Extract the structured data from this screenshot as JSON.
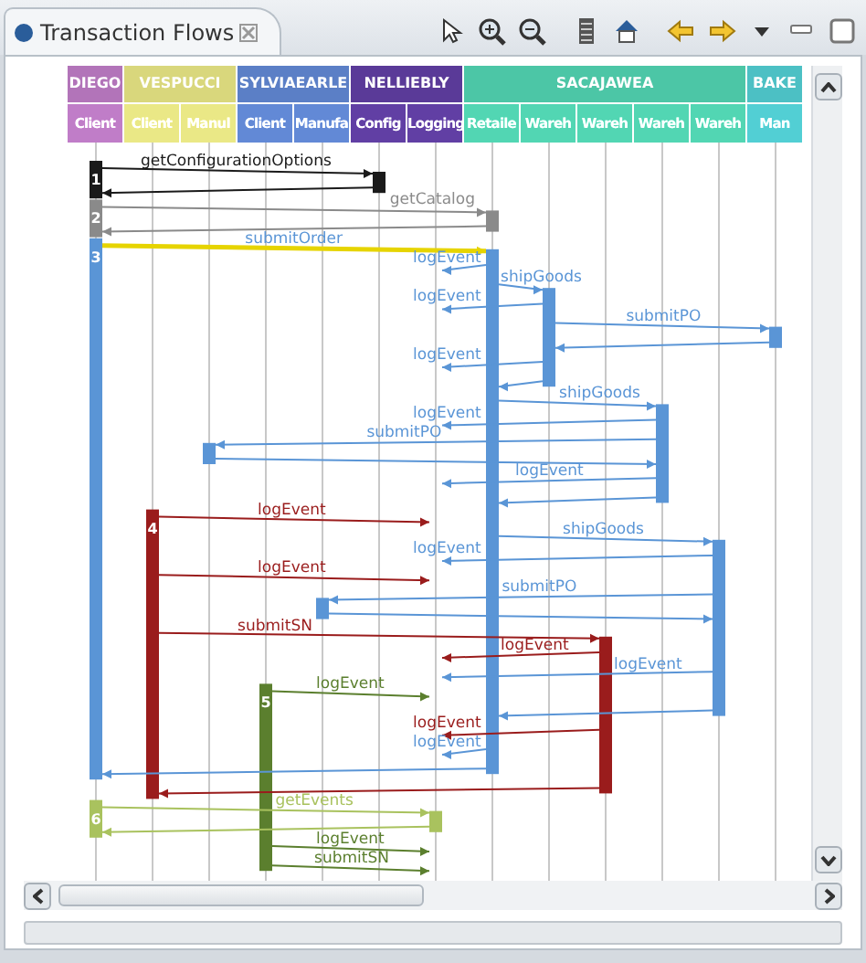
{
  "window": {
    "title": "Transaction Flows"
  },
  "participants": [
    {
      "name": "DIEGO",
      "color": "#b274b9",
      "roles": [
        "Client"
      ]
    },
    {
      "name": "VESPUCCI",
      "color": "#d9d77c",
      "roles": [
        "Client",
        "Manul"
      ]
    },
    {
      "name": "SYLVIAEARLE",
      "color": "#5b7fc6",
      "roles": [
        "Client",
        "Manufa"
      ]
    },
    {
      "name": "NELLIEBLY",
      "color": "#5a3a98",
      "roles": [
        "Config",
        "Logging"
      ]
    },
    {
      "name": "SACAJAWEA",
      "color": "#4cc6a6",
      "roles": [
        "Retaile",
        "Wareh",
        "Wareh",
        "Wareh",
        "Wareh"
      ]
    },
    {
      "name": "BAKE",
      "color": "#4cc0c4",
      "roles": [
        "Man"
      ]
    }
  ],
  "flows": [
    {
      "number": "1",
      "color": "#1a1a1a"
    },
    {
      "number": "2",
      "color": "#8a8a8a"
    },
    {
      "number": "3",
      "color": "#5a95d6"
    },
    {
      "number": "4",
      "color": "#9a1c1c"
    },
    {
      "number": "5",
      "color": "#5b7f2e"
    },
    {
      "number": "6",
      "color": "#a9c25e"
    }
  ],
  "messages": [
    {
      "kind": "call",
      "label": "getConfigurationOptions",
      "selected": false
    },
    {
      "kind": "return",
      "selected": false
    },
    {
      "kind": "call",
      "label": "getCatalog",
      "selected": false
    },
    {
      "kind": "return",
      "selected": false
    },
    {
      "kind": "call",
      "label": "submitOrder",
      "selected": true
    },
    {
      "kind": "log",
      "label": "logEvent",
      "selected": false
    },
    {
      "kind": "call",
      "label": "shipGoods",
      "selected": false
    },
    {
      "kind": "log",
      "label": "logEvent",
      "selected": false
    },
    {
      "kind": "call",
      "label": "submitPO",
      "selected": false
    },
    {
      "kind": "return",
      "selected": false
    },
    {
      "kind": "log",
      "label": "logEvent",
      "selected": false
    },
    {
      "kind": "return",
      "selected": false
    },
    {
      "kind": "call",
      "label": "shipGoods",
      "selected": false
    },
    {
      "kind": "log",
      "label": "logEvent",
      "selected": false
    },
    {
      "kind": "call",
      "label": "submitPO",
      "selected": false
    },
    {
      "kind": "return",
      "selected": false
    },
    {
      "kind": "log",
      "label": "logEvent",
      "selected": false
    },
    {
      "kind": "return",
      "selected": false
    },
    {
      "kind": "log",
      "label": "logEvent",
      "selected": false
    },
    {
      "kind": "call",
      "label": "shipGoods",
      "selected": false
    },
    {
      "kind": "log",
      "label": "logEvent",
      "selected": false
    },
    {
      "kind": "log",
      "label": "logEvent",
      "selected": false
    },
    {
      "kind": "call",
      "label": "submitPO",
      "selected": false
    },
    {
      "kind": "return",
      "selected": false
    },
    {
      "kind": "call",
      "label": "submitSN",
      "selected": false
    },
    {
      "kind": "log",
      "label": "logEvent",
      "selected": false
    },
    {
      "kind": "log",
      "label": "logEvent",
      "selected": false
    },
    {
      "kind": "log",
      "label": "logEvent",
      "selected": false
    },
    {
      "kind": "return",
      "selected": false
    },
    {
      "kind": "log",
      "label": "logEvent",
      "selected": false
    },
    {
      "kind": "log",
      "label": "logEvent",
      "selected": false
    },
    {
      "kind": "return",
      "selected": false
    },
    {
      "kind": "return",
      "selected": false
    },
    {
      "kind": "call",
      "label": "getEvents",
      "selected": false
    },
    {
      "kind": "return",
      "selected": false
    },
    {
      "kind": "log",
      "label": "logEvent",
      "selected": false
    },
    {
      "kind": "log",
      "label": "submitSN",
      "selected": false
    }
  ]
}
